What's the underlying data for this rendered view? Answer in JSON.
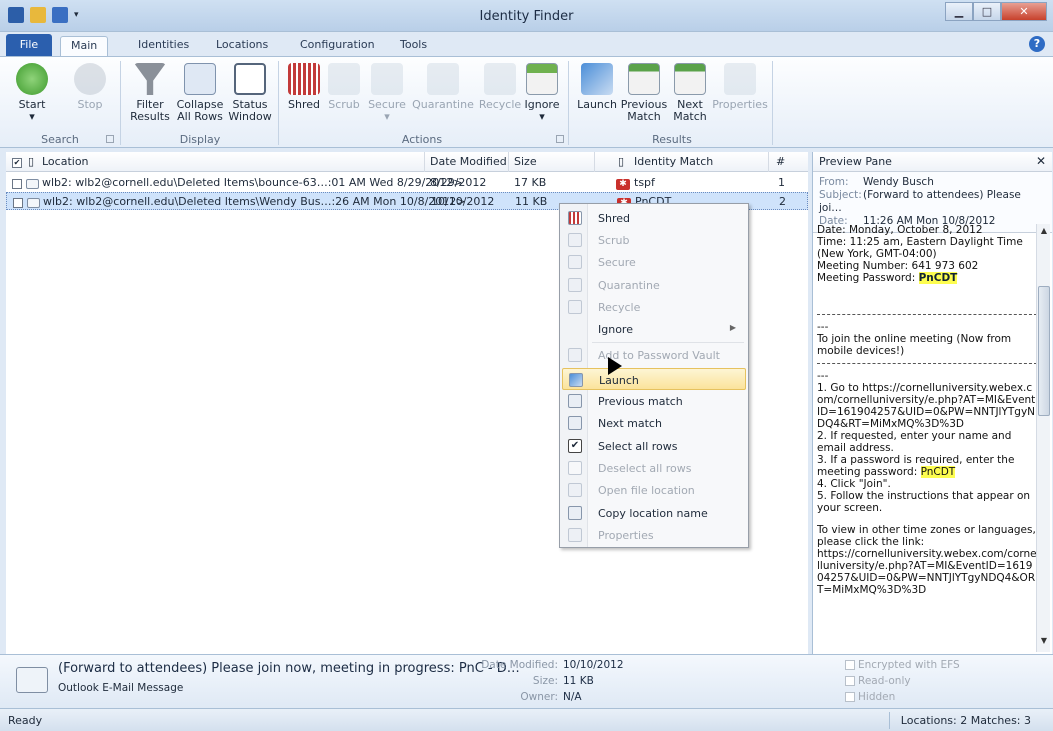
{
  "window": {
    "title": "Identity Finder"
  },
  "tabs": [
    "File",
    "Main",
    "Identities",
    "Locations",
    "Configuration",
    "Tools"
  ],
  "ribbon": {
    "groups": {
      "search": "Search",
      "display": "Display",
      "actions": "Actions",
      "results": "Results"
    },
    "start": "Start",
    "stop": "Stop",
    "filter1": "Filter",
    "filter2": "Results",
    "collapse1": "Collapse",
    "collapse2": "All Rows",
    "status1": "Status",
    "status2": "Window",
    "shred": "Shred",
    "scrub": "Scrub",
    "secure": "Secure",
    "quarantine": "Quarantine",
    "recycle": "Recycle",
    "ignore": "Ignore",
    "launch": "Launch",
    "previous1": "Previous",
    "previous2": "Match",
    "next1": "Next",
    "next2": "Match",
    "properties": "Properties"
  },
  "grid": {
    "headers": {
      "location": "Location",
      "date": "Date Modified",
      "size": "Size",
      "match": "Identity Match",
      "num": "#"
    },
    "rows": [
      {
        "location": "wlb2: wlb2@cornell.edu\\Deleted Items\\bounce-63…:01 AM Wed 8/29/2012>",
        "date": "8/29/2012",
        "size": "17 KB",
        "match": "tspf",
        "num": "1"
      },
      {
        "location": "wlb2: wlb2@cornell.edu\\Deleted Items\\Wendy Bus…:26 AM Mon 10/8/2012>",
        "date": "10/10/2012",
        "size": "11 KB",
        "match": "PnCDT",
        "num": "2"
      }
    ]
  },
  "menu": {
    "shred": "Shred",
    "scrub": "Scrub",
    "secure": "Secure",
    "quarantine": "Quarantine",
    "recycle": "Recycle",
    "ignore": "Ignore",
    "vault": "Add to Password Vault",
    "launch": "Launch",
    "prev": "Previous match",
    "next": "Next match",
    "selectall": "Select all rows",
    "deselect": "Deselect all rows",
    "openloc": "Open file location",
    "copyloc": "Copy location name",
    "props": "Properties"
  },
  "preview": {
    "title": "Preview Pane",
    "from_k": "From:",
    "from_v": "Wendy Busch",
    "subj_k": "Subject:",
    "subj_v": "(Forward to attendees) Please joi…",
    "date_k": "Date:",
    "date_v": "11:26 AM Mon 10/8/2012",
    "b1": "Date: Monday, October 8, 2012",
    "b2": "Time: 11:25 am, Eastern Daylight Time (New York, GMT-04:00)",
    "b3": "Meeting Number: 641 973 602",
    "b4": "Meeting Password: ",
    "pw": "PnCDT",
    "b5": "---",
    "b6": "To join the online meeting (Now from mobile devices!)",
    "b7": "---",
    "b8": "1. Go to https://cornelluniversity.webex.com/cornelluniversity/e.php?AT=MI&EventID=161904257&UID=0&PW=NNTJlYTgyNDQ4&RT=MiMxMQ%3D%3D",
    "b9": "2. If requested, enter your name and email address.",
    "b10": "3. If a password is required, enter the meeting password: ",
    "pw2": "PnCDT",
    "b11": "4. Click \"Join\".",
    "b12": "5. Follow the instructions that appear on your screen.",
    "b13": "To view in other time zones or languages, please click the link:",
    "b14": "https://cornelluniversity.webex.com/cornelluniversity/e.php?AT=MI&EventID=161904257&UID=0&PW=NNTJlYTgyNDQ4&ORT=MiMxMQ%3D%3D"
  },
  "details": {
    "subject": "(Forward to attendees) Please join now, meeting in progress: PnC - D…",
    "type": "Outlook E-Mail Message",
    "date_k": "Date Modified:",
    "date_v": "10/10/2012",
    "size_k": "Size:",
    "size_v": "11 KB",
    "owner_k": "Owner:",
    "owner_v": "N/A",
    "enc": "Encrypted with EFS",
    "ro": "Read-only",
    "hidden": "Hidden"
  },
  "status": {
    "left": "Ready",
    "right": "Locations: 2  Matches: 3"
  },
  "colors": {
    "accent": "#2b5fae",
    "highlight": "#fdfd50",
    "selection": "#cfe3fb"
  }
}
